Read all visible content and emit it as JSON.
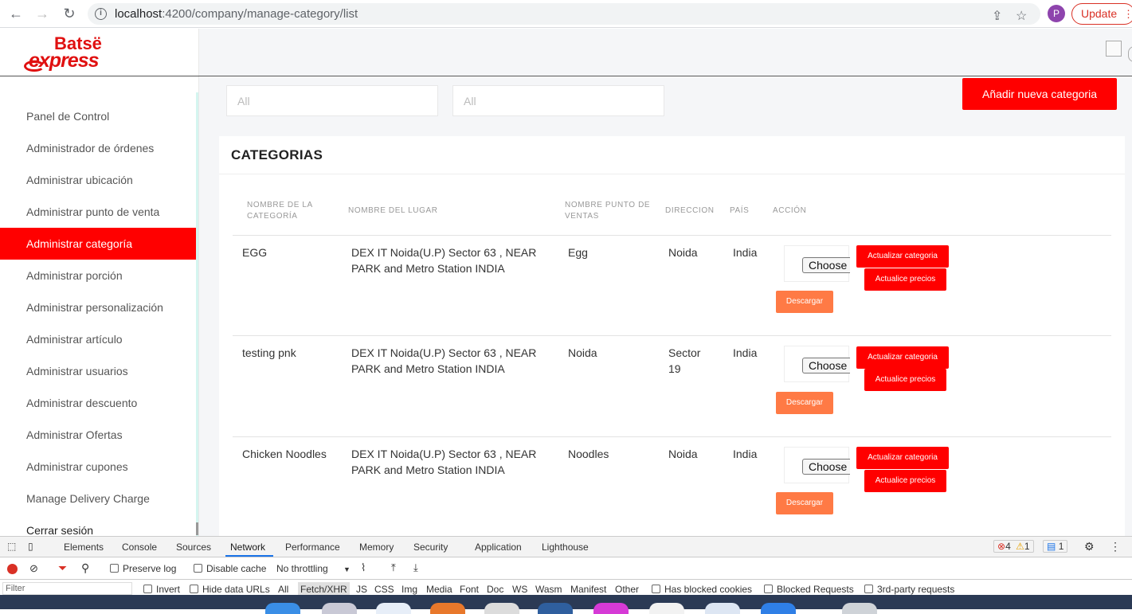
{
  "browser": {
    "url_host": "localhost",
    "url_path": ":4200/company/manage-category/list",
    "profile_initial": "P",
    "update_label": "Update"
  },
  "logo": {
    "top": "Batsë",
    "bottom": "express"
  },
  "sidebar": {
    "items": [
      {
        "label": "Panel de Control"
      },
      {
        "label": "Administrador de órdenes"
      },
      {
        "label": "Administrar ubicación"
      },
      {
        "label": "Administrar punto de venta"
      },
      {
        "label": "Administrar categoría"
      },
      {
        "label": "Administrar porción"
      },
      {
        "label": "Administrar personalización"
      },
      {
        "label": "Administrar artículo"
      },
      {
        "label": "Administrar usuarios"
      },
      {
        "label": "Administrar descuento"
      },
      {
        "label": "Administrar Ofertas"
      },
      {
        "label": "Administrar cupones"
      },
      {
        "label": "Manage Delivery Charge"
      },
      {
        "label": "Cerrar sesión"
      }
    ],
    "active_index": 4
  },
  "filters": [
    {
      "placeholder": "All"
    },
    {
      "placeholder": "All"
    }
  ],
  "add_button_label": "Añadir nueva categoria",
  "panel_title": "CATEGORIAS",
  "table": {
    "headers": [
      "NOMBRE DE LA CATEGORÍA",
      "NOMBRE DEL LUGAR",
      "NOMBRE PUNTO DE VENTAS",
      "DIRECCION",
      "PAÍS",
      "ACCIÓN"
    ],
    "rows": [
      {
        "name": "EGG",
        "place": "DEX IT Noida(U.P) Sector 63 , NEAR PARK and Metro Station INDIA",
        "outlet": "Egg",
        "address": "Noida",
        "country": "India"
      },
      {
        "name": "testing pnk",
        "place": "DEX IT Noida(U.P) Sector 63 , NEAR PARK and Metro Station INDIA",
        "outlet": "Noida",
        "address": "Sector 19",
        "country": "India"
      },
      {
        "name": "Chicken Noodles",
        "place": "DEX IT Noida(U.P) Sector 63 , NEAR PARK and Metro Station INDIA",
        "outlet": "Noodles",
        "address": "Noida",
        "country": "India"
      }
    ],
    "choose_label": "Choose",
    "update_category_label": "Actualizar categoria",
    "update_prices_label": "Actualice precios",
    "download_label": "Descargar"
  },
  "devtools": {
    "tabs": [
      "Elements",
      "Console",
      "Sources",
      "Network",
      "Performance",
      "Memory",
      "Security",
      "Application",
      "Lighthouse"
    ],
    "active_tab": "Network",
    "errors": "4",
    "warnings": "1",
    "messages": "1",
    "preserve_log": "Preserve log",
    "disable_cache": "Disable cache",
    "throttling": "No throttling",
    "filter_placeholder": "Filter",
    "invert": "Invert",
    "hide_data_urls": "Hide data URLs",
    "types": [
      "All",
      "Fetch/XHR",
      "JS",
      "CSS",
      "Img",
      "Media",
      "Font",
      "Doc",
      "WS",
      "Wasm",
      "Manifest",
      "Other"
    ],
    "has_blocked_cookies": "Has blocked cookies",
    "blocked_requests": "Blocked Requests",
    "third_party": "3rd-party requests"
  },
  "colors": {
    "brand_red": "#ff0000",
    "download_orange": "#ff7a45"
  }
}
